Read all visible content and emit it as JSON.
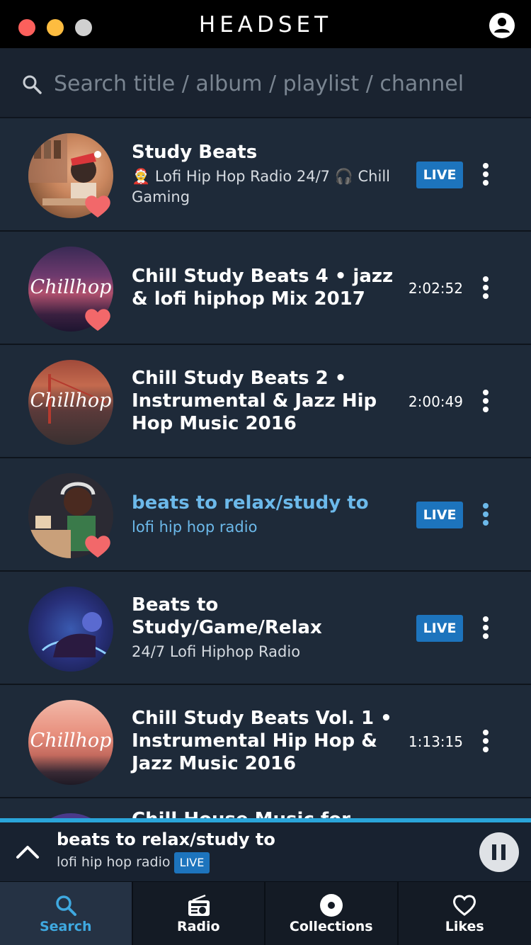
{
  "app": {
    "logo": "HEADSET"
  },
  "search": {
    "placeholder": "Search title / album / playlist / channel",
    "value": ""
  },
  "results": [
    {
      "title": "Study Beats",
      "subtitle": "🤶 Lofi Hip Hop Radio 24/7 🎧 Chill Gaming",
      "badge": "LIVE",
      "liked": true,
      "active": false
    },
    {
      "title": "Chill Study Beats 4 • jazz & lofi hiphop Mix 2017",
      "duration": "2:02:52",
      "thumb_text": "Chillhop",
      "liked": true,
      "active": false
    },
    {
      "title": "Chill Study Beats 2 • Instrumental & Jazz Hip Hop Music 2016",
      "duration": "2:00:49",
      "thumb_text": "Chillhop",
      "liked": false,
      "active": false
    },
    {
      "title": "beats to relax/study to",
      "subtitle": "lofi hip hop radio",
      "badge": "LIVE",
      "liked": true,
      "active": true
    },
    {
      "title": "Beats to Study/Game/Relax",
      "subtitle": "24/7 Lofi Hiphop Radio",
      "badge": "LIVE",
      "liked": false,
      "active": false
    },
    {
      "title": "Chill Study Beats Vol. 1 • Instrumental Hip Hop & Jazz Music 2016",
      "duration": "1:13:15",
      "thumb_text": "Chillhop",
      "liked": false,
      "active": false
    },
    {
      "title": "Chill House Music for",
      "partial": true
    }
  ],
  "now_playing": {
    "title": "beats to relax/study to",
    "subtitle": "lofi hip hop radio",
    "badge": "LIVE"
  },
  "tabs": [
    {
      "label": "Search",
      "icon": "search-icon",
      "active": true
    },
    {
      "label": "Radio",
      "icon": "radio-icon",
      "active": false
    },
    {
      "label": "Collections",
      "icon": "disc-icon",
      "active": false
    },
    {
      "label": "Likes",
      "icon": "heart-outline-icon",
      "active": false
    }
  ],
  "colors": {
    "accent": "#3fa9e0",
    "live_badge": "#1d74bd",
    "heart": "#f2686a",
    "active_text": "#6cb9ea"
  }
}
